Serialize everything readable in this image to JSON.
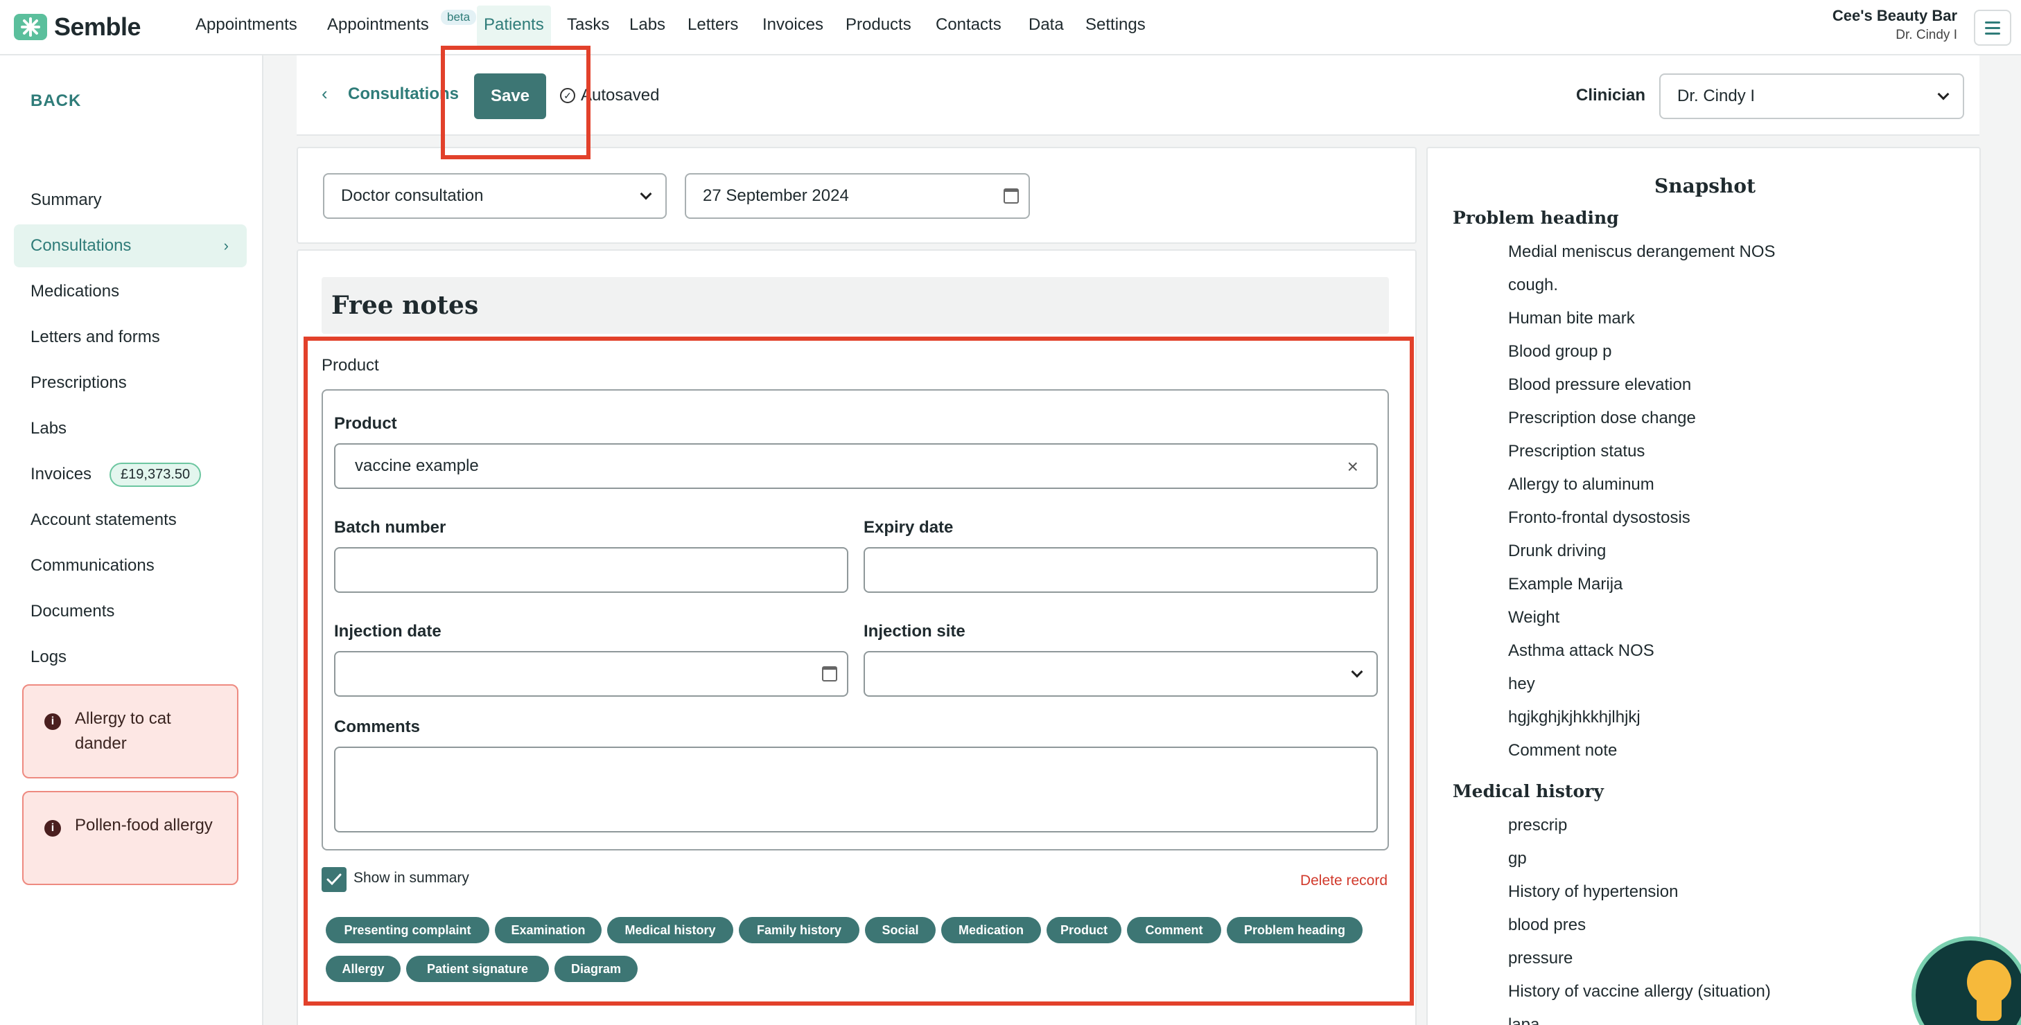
{
  "nav": {
    "brand": "Semble",
    "items": [
      "Appointments",
      "Appointments",
      "Patients",
      "Tasks",
      "Labs",
      "Letters",
      "Invoices",
      "Products",
      "Contacts",
      "Data",
      "Settings"
    ],
    "beta_badge": "beta",
    "account_name": "Cee's Beauty Bar",
    "account_user": "Dr. Cindy I"
  },
  "sidebar": {
    "back": "BACK",
    "items": [
      "Summary",
      "Consultations",
      "Medications",
      "Letters and forms",
      "Prescriptions",
      "Labs",
      "Invoices",
      "Account statements",
      "Communications",
      "Documents",
      "Logs"
    ],
    "invoice_balance": "£19,373.50",
    "alerts": [
      "Allergy to cat dander",
      "Pollen-food allergy"
    ]
  },
  "header": {
    "breadcrumb": "Consultations",
    "save_label": "Save",
    "autosaved": "Autosaved",
    "clinician_label": "Clinician",
    "clinician_value": "Dr. Cindy I"
  },
  "consultation": {
    "type": "Doctor consultation",
    "date": "27 September 2024"
  },
  "notes": {
    "title": "Free notes",
    "section_label": "Product",
    "product_label": "Product",
    "product_value": "vaccine example",
    "batch_label": "Batch number",
    "batch_value": "",
    "expiry_label": "Expiry date",
    "expiry_value": "",
    "injection_date_label": "Injection date",
    "injection_site_label": "Injection site",
    "comments_label": "Comments",
    "show_in_summary": "Show in summary",
    "delete_record": "Delete record",
    "chips": [
      "Presenting complaint",
      "Examination",
      "Medical history",
      "Family history",
      "Social",
      "Medication",
      "Product",
      "Comment",
      "Problem heading",
      "Allergy",
      "Patient signature",
      "Diagram"
    ]
  },
  "snapshot": {
    "title": "Snapshot",
    "problem_heading": "Problem heading",
    "problems": [
      "Medial meniscus derangement NOS",
      "cough.",
      "Human bite mark",
      "Blood group p",
      "Blood pressure elevation",
      "Prescription dose change",
      "Prescription status",
      "Allergy to aluminum",
      "Fronto-frontal dysostosis",
      "Drunk driving",
      "Example Marija",
      "Weight",
      "Asthma attack NOS",
      "hey",
      "hgjkghjkjhkkhjlhjkj",
      "Comment note"
    ],
    "medical_history_heading": "Medical history",
    "medical_history": [
      "prescrip",
      "gp",
      "History of hypertension",
      "blood pres",
      "pressure",
      "History of vaccine allergy (situation)",
      "lapa"
    ]
  }
}
